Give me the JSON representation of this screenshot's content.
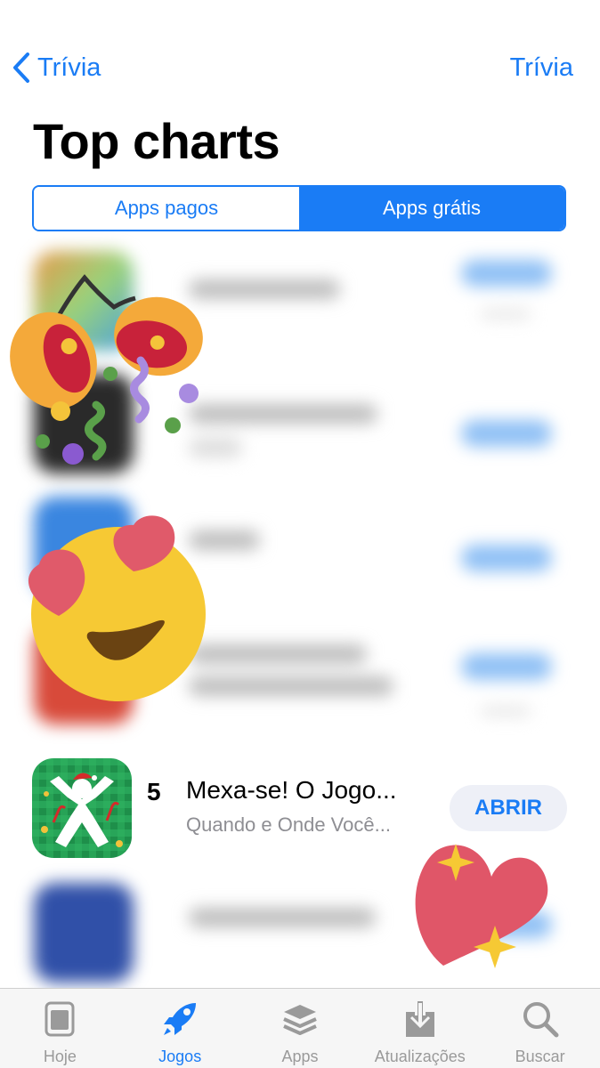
{
  "nav": {
    "back_label": "Trívia",
    "right_label": "Trívia"
  },
  "page_title": "Top charts",
  "segments": [
    {
      "label": "Apps pagos",
      "selected": false
    },
    {
      "label": "Apps grátis",
      "selected": true
    }
  ],
  "featured_app": {
    "rank": "5",
    "name": "Mexa-se! O Jogo...",
    "subtitle": "Quando e Onde Você...",
    "action": "ABRIR"
  },
  "tabbar": {
    "tabs": [
      {
        "label": "Hoje",
        "icon": "today-icon",
        "active": false
      },
      {
        "label": "Jogos",
        "icon": "rocket-icon",
        "active": true
      },
      {
        "label": "Apps",
        "icon": "apps-stack-icon",
        "active": false
      },
      {
        "label": "Atualizações",
        "icon": "updates-icon",
        "active": false
      },
      {
        "label": "Buscar",
        "icon": "search-icon",
        "active": false
      }
    ]
  },
  "colors": {
    "accent": "#1a7cf5",
    "button_bg": "#eef0f7",
    "secondary_text": "#8e8e93"
  }
}
